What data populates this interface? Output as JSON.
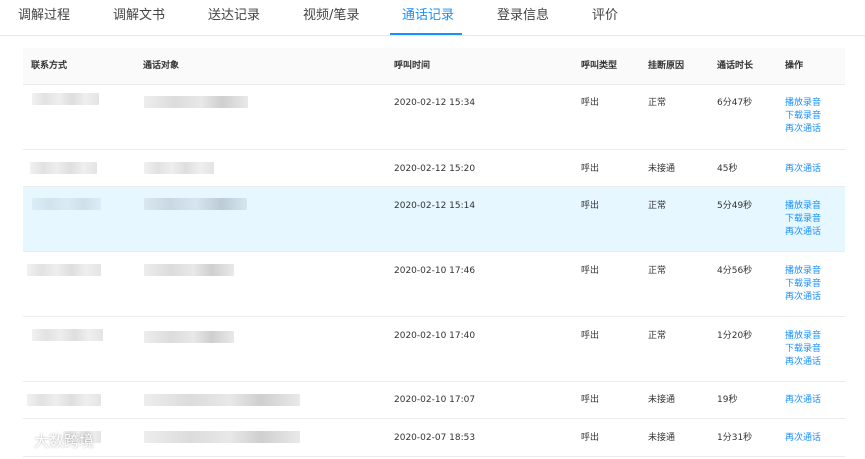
{
  "tabs": [
    {
      "label": "调解过程",
      "active": false
    },
    {
      "label": "调解文书",
      "active": false
    },
    {
      "label": "送达记录",
      "active": false
    },
    {
      "label": "视频/笔录",
      "active": false
    },
    {
      "label": "通话记录",
      "active": true
    },
    {
      "label": "登录信息",
      "active": false
    },
    {
      "label": "评价",
      "active": false
    }
  ],
  "table": {
    "headers": [
      "联系方式",
      "通话对象",
      "呼叫时间",
      "呼叫类型",
      "挂断原因",
      "通话时长",
      "操作"
    ],
    "rows": [
      {
        "time": "2020-02-12 15:34",
        "type": "呼出",
        "reason": "正常",
        "duration": "6分47秒",
        "actions": [
          "播放录音",
          "下载录音",
          "再次通话"
        ]
      },
      {
        "time": "2020-02-12 15:20",
        "type": "呼出",
        "reason": "未接通",
        "duration": "45秒",
        "actions": [
          "再次通话"
        ]
      },
      {
        "time": "2020-02-12 15:14",
        "type": "呼出",
        "reason": "正常",
        "duration": "5分49秒",
        "actions": [
          "播放录音",
          "下载录音",
          "再次通话"
        ]
      },
      {
        "time": "2020-02-10 17:46",
        "type": "呼出",
        "reason": "正常",
        "duration": "4分56秒",
        "actions": [
          "播放录音",
          "下载录音",
          "再次通话"
        ]
      },
      {
        "time": "2020-02-10 17:40",
        "type": "呼出",
        "reason": "正常",
        "duration": "1分20秒",
        "actions": [
          "播放录音",
          "下载录音",
          "再次通话"
        ]
      },
      {
        "time": "2020-02-10 17:07",
        "type": "呼出",
        "reason": "未接通",
        "duration": "19秒",
        "actions": [
          "再次通话"
        ]
      },
      {
        "time": "2020-02-07 18:53",
        "type": "呼出",
        "reason": "未接通",
        "duration": "1分31秒",
        "actions": [
          "再次通话"
        ]
      }
    ]
  },
  "watermark": {
    "text": "大数跨境",
    "icon": "logo-icon"
  },
  "colors": {
    "accent": "#1890ff",
    "highlight_row": "#e6f7ff",
    "header_bg": "#fafafa"
  }
}
